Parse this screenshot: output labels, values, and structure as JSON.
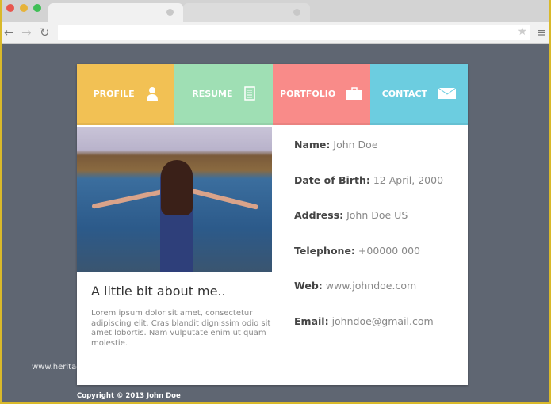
{
  "browser": {
    "colors": {
      "close": "#e8564e",
      "min": "#e6b33a",
      "max": "#3fbf56"
    }
  },
  "nav": [
    {
      "label": "PROFILE",
      "icon": "user-icon",
      "color": "#f2c154"
    },
    {
      "label": "RESUME",
      "icon": "document-icon",
      "color": "#9fdfb4"
    },
    {
      "label": "PORTFOLIO",
      "icon": "briefcase-icon",
      "color": "#f98b89"
    },
    {
      "label": "CONTACT",
      "icon": "envelope-icon",
      "color": "#6ccde0"
    }
  ],
  "about": {
    "title": "A little bit about me..",
    "text": "Lorem ipsum dolor sit amet, consectetur adipiscing elit. Cras blandit dignissim odio sit amet lobortis. Nam vulputate enim ut quam molestie."
  },
  "info": [
    {
      "label": "Name:",
      "value": "John Doe"
    },
    {
      "label": "Date of Birth:",
      "value": "12 April, 2000"
    },
    {
      "label": "Address:",
      "value": "John Doe US"
    },
    {
      "label": "Telephone:",
      "value": "+00000 000"
    },
    {
      "label": "Web:",
      "value": "www.johndoe.com"
    },
    {
      "label": "Email:",
      "value": "johndoe@gmail.com"
    }
  ],
  "footer": {
    "copyright": "Copyright © 2013 John Doe"
  },
  "watermark": "www.heritagechristiancollege.com"
}
